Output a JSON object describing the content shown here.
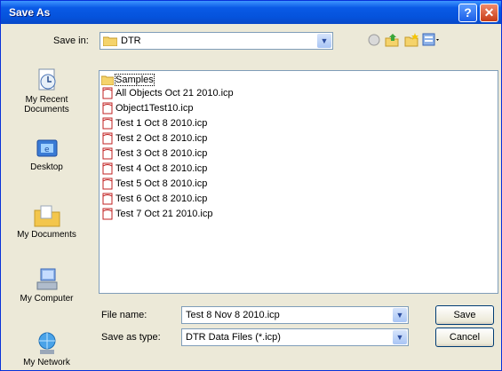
{
  "window": {
    "title": "Save As"
  },
  "titlebar": {
    "help_glyph": "?",
    "close_glyph": "✕"
  },
  "toolbar": {
    "save_in_label": "Save in:",
    "save_in_value": "DTR",
    "icons": [
      "back-icon",
      "up-folder-icon",
      "new-folder-icon",
      "views-menu-icon"
    ]
  },
  "places": [
    {
      "label": "My Recent Documents",
      "icon": "recent-documents-icon"
    },
    {
      "label": "Desktop",
      "icon": "desktop-icon"
    },
    {
      "label": "My Documents",
      "icon": "my-documents-icon"
    },
    {
      "label": "My Computer",
      "icon": "my-computer-icon"
    },
    {
      "label": "My Network",
      "icon": "my-network-icon"
    }
  ],
  "files": [
    {
      "name": "Samples",
      "type": "folder"
    },
    {
      "name": "All Objects Oct 21 2010.icp",
      "type": "file"
    },
    {
      "name": "Object1Test10.icp",
      "type": "file"
    },
    {
      "name": "Test 1 Oct 8 2010.icp",
      "type": "file"
    },
    {
      "name": "Test 2 Oct 8 2010.icp",
      "type": "file"
    },
    {
      "name": "Test 3 Oct 8 2010.icp",
      "type": "file"
    },
    {
      "name": "Test 4 Oct 8 2010.icp",
      "type": "file"
    },
    {
      "name": "Test 5 Oct 8 2010.icp",
      "type": "file"
    },
    {
      "name": "Test 6 Oct 8 2010.icp",
      "type": "file"
    },
    {
      "name": "Test 7 Oct 21 2010.icp",
      "type": "file"
    }
  ],
  "form": {
    "file_name_label": "File name:",
    "file_name_value": "Test 8 Nov 8 2010.icp",
    "save_type_label": "Save as type:",
    "save_type_value": "DTR Data Files (*.icp)"
  },
  "buttons": {
    "save": "Save",
    "cancel": "Cancel"
  },
  "colors": {
    "titlebar": "#0553dc",
    "dialog_bg": "#ece9d8",
    "field_border": "#7f9db9"
  }
}
